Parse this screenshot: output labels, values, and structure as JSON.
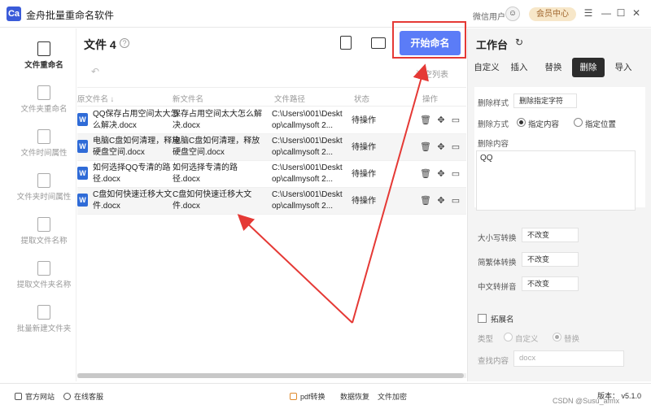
{
  "app": {
    "logo": "Ca",
    "title": "金舟批量重命名软件",
    "wx_user": "微信用户",
    "vip": "会员中心",
    "win_controls": [
      "☰",
      "—",
      "☐",
      "✕"
    ]
  },
  "sidebar": {
    "items": [
      {
        "label": "文件重命名",
        "icon": "file-rename-icon"
      },
      {
        "label": "文件夹重命名",
        "icon": "folder-rename-icon"
      },
      {
        "label": "文件时间属性",
        "icon": "file-time-icon"
      },
      {
        "label": "文件夹时间属性",
        "icon": "folder-time-icon"
      },
      {
        "label": "提取文件名称",
        "icon": "extract-file-icon"
      },
      {
        "label": "提取文件夹名称",
        "icon": "extract-folder-icon"
      },
      {
        "label": "批量新建文件夹",
        "icon": "new-folder-icon"
      }
    ]
  },
  "main": {
    "title": "文件 4",
    "start_button": "开始命名",
    "clear_list": "清空列表",
    "columns": [
      "原文件名 ↓",
      "新文件名",
      "文件路径",
      "状态",
      "操作"
    ],
    "rows": [
      {
        "orig": "QQ保存占用空间太大怎么解决.docx",
        "new": "保存占用空间太大怎么解决.docx",
        "path": "C:\\Users\\001\\Desktop\\callmysoft 2...",
        "status": "待操作"
      },
      {
        "orig": "电脑C盘如何清理，释放硬盘空间.docx",
        "new": "电脑C盘如何清理，释放硬盘空间.docx",
        "path": "C:\\Users\\001\\Desktop\\callmysoft 2...",
        "status": "待操作"
      },
      {
        "orig": "如何选择QQ专清的路径.docx",
        "new": "如何选择专清的路径.docx",
        "path": "C:\\Users\\001\\Desktop\\callmysoft 2...",
        "status": "待操作"
      },
      {
        "orig": "C盘如何快速迁移大文件.docx",
        "new": "C盘如何快速迁移大文件.docx",
        "path": "C:\\Users\\001\\Desktop\\callmysoft 2...",
        "status": "待操作"
      }
    ]
  },
  "workspace": {
    "title": "工作台",
    "tabs": [
      "自定义",
      "插入",
      "替换",
      "删除",
      "导入"
    ],
    "active_tab": "删除",
    "delete_style_label": "删除样式",
    "delete_style_value": "删除指定字符",
    "delete_mode_label": "删除方式",
    "mode_content": "指定内容",
    "mode_position": "指定位置",
    "delete_content_label": "删除内容",
    "delete_content_value": "QQ",
    "case_label": "大小写转换",
    "case_value": "不改变",
    "trad_label": "简繁体转换",
    "trad_value": "不改变",
    "pinyin_label": "中文转拼音",
    "pinyin_value": "不改变",
    "ext_label": "拓展名",
    "type_label": "类型",
    "type_custom": "自定义",
    "type_replace": "替换",
    "find_label": "查找内容",
    "find_placeholder": "docx"
  },
  "status": {
    "website": "官方网站",
    "support": "在线客服",
    "pdf": "pdf转换",
    "recover": "数据恢复",
    "encrypt": "文件加密",
    "version": "版本： v5.1.0",
    "watermark": "CSDN @Susu_afmx"
  },
  "colors": {
    "accent": "#5b7cf7",
    "annotation": "#e53935"
  }
}
